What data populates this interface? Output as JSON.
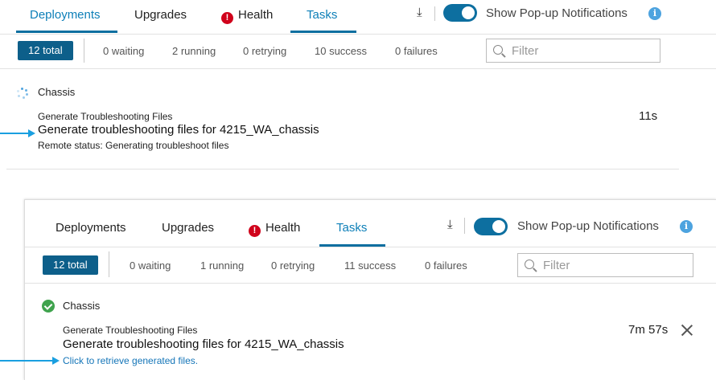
{
  "top": {
    "tabs": {
      "deployments": "Deployments",
      "upgrades": "Upgrades",
      "health": "Health",
      "tasks": "Tasks"
    },
    "download_glyph": "⤓",
    "notifications_label": "Show Pop-up Notifications",
    "notifications_on": true,
    "stats": {
      "total": "12 total",
      "waiting": "0 waiting",
      "running": "2 running",
      "retrying": "0 retrying",
      "success": "10 success",
      "failures": "0 failures"
    },
    "filter_placeholder": "Filter",
    "group_title": "Chassis",
    "task": {
      "type": "Generate Troubleshooting Files",
      "name": "Generate troubleshooting files for 4215_WA_chassis",
      "status": "Remote status: Generating troubleshoot files",
      "duration": "11s",
      "state": "running"
    }
  },
  "bottom": {
    "tabs": {
      "deployments": "Deployments",
      "upgrades": "Upgrades",
      "health": "Health",
      "tasks": "Tasks"
    },
    "download_glyph": "⤓",
    "notifications_label": "Show Pop-up Notifications",
    "notifications_on": true,
    "stats": {
      "total": "12 total",
      "waiting": "0 waiting",
      "running": "1 running",
      "retrying": "0 retrying",
      "success": "11 success",
      "failures": "0 failures"
    },
    "filter_placeholder": "Filter",
    "group_title": "Chassis",
    "task": {
      "type": "Generate Troubleshooting Files",
      "name": "Generate troubleshooting files for 4215_WA_chassis",
      "link": "Click to retrieve generated files.",
      "duration": "7m 57s",
      "state": "success"
    }
  },
  "colors": {
    "accent": "#0d6fa0",
    "tab_active_text": "#0d7fb8",
    "badge": "#0d5f8a",
    "health_alert": "#d0021b",
    "success": "#3fa34d",
    "link": "#1475b8",
    "annotation_arrow": "#1a9fe0"
  },
  "icons": [
    "health-alert-icon",
    "download-icon",
    "info-icon",
    "search-icon",
    "spinner-icon",
    "check-icon",
    "close-icon"
  ]
}
